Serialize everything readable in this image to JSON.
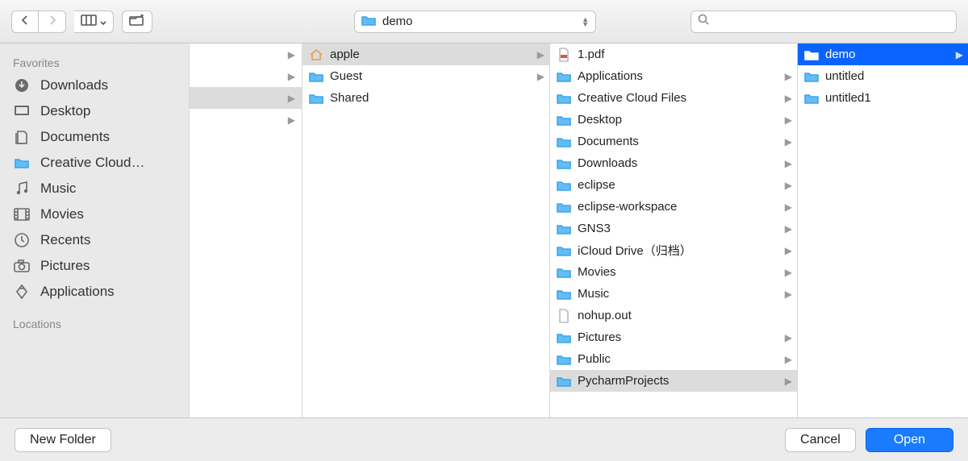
{
  "toolbar": {
    "current_path_label": "demo",
    "search_placeholder": ""
  },
  "sidebar": {
    "favorites_label": "Favorites",
    "locations_label": "Locations",
    "items": [
      {
        "label": "Downloads",
        "icon": "download-circle-icon"
      },
      {
        "label": "Desktop",
        "icon": "desktop-icon"
      },
      {
        "label": "Documents",
        "icon": "documents-icon"
      },
      {
        "label": "Creative Cloud…",
        "icon": "folder-icon"
      },
      {
        "label": "Music",
        "icon": "music-icon"
      },
      {
        "label": "Movies",
        "icon": "movies-icon"
      },
      {
        "label": "Recents",
        "icon": "clock-icon"
      },
      {
        "label": "Pictures",
        "icon": "camera-icon"
      },
      {
        "label": "Applications",
        "icon": "applications-icon"
      }
    ]
  },
  "column0": {
    "items": [
      {
        "has_children": true,
        "highlight": false
      },
      {
        "has_children": true,
        "highlight": false
      },
      {
        "has_children": true,
        "highlight": true
      },
      {
        "has_children": true,
        "highlight": false
      }
    ]
  },
  "column1": {
    "items": [
      {
        "label": "apple",
        "icon": "home-icon",
        "has_children": true,
        "highlight": true
      },
      {
        "label": "Guest",
        "icon": "folder-icon",
        "has_children": true,
        "highlight": false
      },
      {
        "label": "Shared",
        "icon": "folder-icon",
        "has_children": false,
        "highlight": false
      }
    ]
  },
  "column2": {
    "items": [
      {
        "label": "1.pdf",
        "icon": "pdf-icon",
        "has_children": false
      },
      {
        "label": "Applications",
        "icon": "app-folder-icon",
        "has_children": true
      },
      {
        "label": "Creative Cloud Files",
        "icon": "folder-icon",
        "has_children": true
      },
      {
        "label": "Desktop",
        "icon": "desktop-folder-icon",
        "has_children": true
      },
      {
        "label": "Documents",
        "icon": "folder-icon",
        "has_children": true
      },
      {
        "label": "Downloads",
        "icon": "download-folder-icon",
        "has_children": true
      },
      {
        "label": "eclipse",
        "icon": "folder-icon",
        "has_children": true
      },
      {
        "label": "eclipse-workspace",
        "icon": "folder-icon",
        "has_children": true
      },
      {
        "label": "GNS3",
        "icon": "folder-icon",
        "has_children": true
      },
      {
        "label": "iCloud Drive（归档）",
        "icon": "folder-icon",
        "has_children": true
      },
      {
        "label": "Movies",
        "icon": "movies-folder-icon",
        "has_children": true
      },
      {
        "label": "Music",
        "icon": "music-folder-icon",
        "has_children": true
      },
      {
        "label": "nohup.out",
        "icon": "blank-file-icon",
        "has_children": false
      },
      {
        "label": "Pictures",
        "icon": "pictures-folder-icon",
        "has_children": true
      },
      {
        "label": "Public",
        "icon": "folder-icon",
        "has_children": true
      },
      {
        "label": "PycharmProjects",
        "icon": "folder-icon",
        "has_children": true,
        "highlight": true
      }
    ]
  },
  "column3": {
    "items": [
      {
        "label": "demo",
        "icon": "folder-icon",
        "has_children": true,
        "selected": true
      },
      {
        "label": "untitled",
        "icon": "folder-icon",
        "has_children": false
      },
      {
        "label": "untitled1",
        "icon": "folder-icon",
        "has_children": false
      }
    ]
  },
  "footer": {
    "new_folder_label": "New Folder",
    "cancel_label": "Cancel",
    "open_label": "Open"
  },
  "colors": {
    "accent": "#1a7bff",
    "folder": "#62bdf6"
  }
}
